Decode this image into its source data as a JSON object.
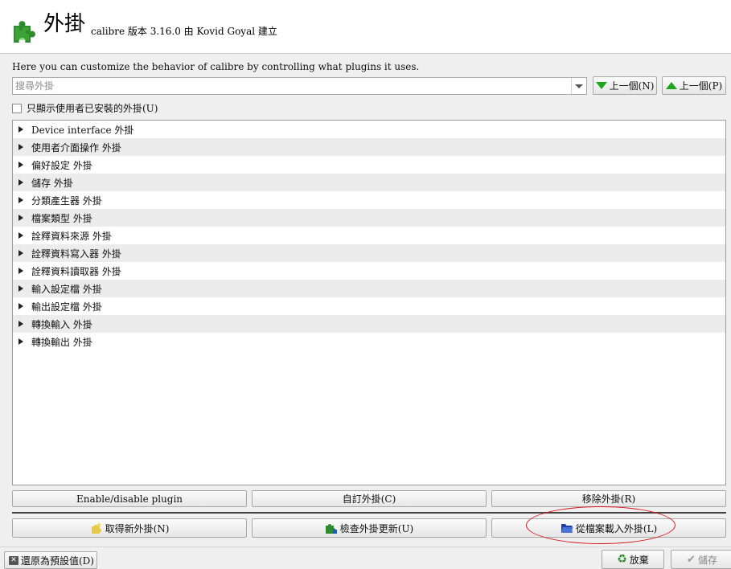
{
  "header": {
    "title": "外掛",
    "subtitle": "calibre 版本 3.16.0 由 Kovid Goyal 建立"
  },
  "description": "Here you can customize the behavior of calibre by controlling what plugins it uses.",
  "search": {
    "placeholder": "搜尋外掛",
    "value": "",
    "next_label": "上一個(N)",
    "prev_label": "上一個(P)"
  },
  "filter": {
    "only_user_label": "只顯示使用者已安裝的外掛(U)",
    "checked": false
  },
  "plugin_categories": [
    "Device interface 外掛",
    "使用者介面操作 外掛",
    "偏好設定 外掛",
    "儲存 外掛",
    "分類產生器 外掛",
    "檔案類型 外掛",
    "詮釋資料來源 外掛",
    "詮釋資料寫入器 外掛",
    "詮釋資料讀取器 外掛",
    "輸入設定檔 外掛",
    "輸出設定檔 外掛",
    "轉換輸入 外掛",
    "轉換輸出 外掛"
  ],
  "actions": {
    "enable_disable": "Enable/disable plugin",
    "customize": "自訂外掛(C)",
    "remove": "移除外掛(R)",
    "get_new": "取得新外掛(N)",
    "check_updates": "檢查外掛更新(U)",
    "load_from_file": "從檔案載入外掛(L)"
  },
  "footer": {
    "restore_defaults": "還原為預設值(D)",
    "discard": "放棄",
    "save": "儲存"
  },
  "colors": {
    "accent_green": "#1ea51e",
    "highlight_oval": "#d8141b"
  },
  "icons": {
    "logo": "puzzle-piece-icon",
    "get_new": "puzzle-star-icon",
    "check_updates": "puzzle-update-icon",
    "load_from_file": "folder-open-icon",
    "discard": "recycle-icon",
    "save": "checkmark-icon",
    "restore": "x-box-icon"
  }
}
